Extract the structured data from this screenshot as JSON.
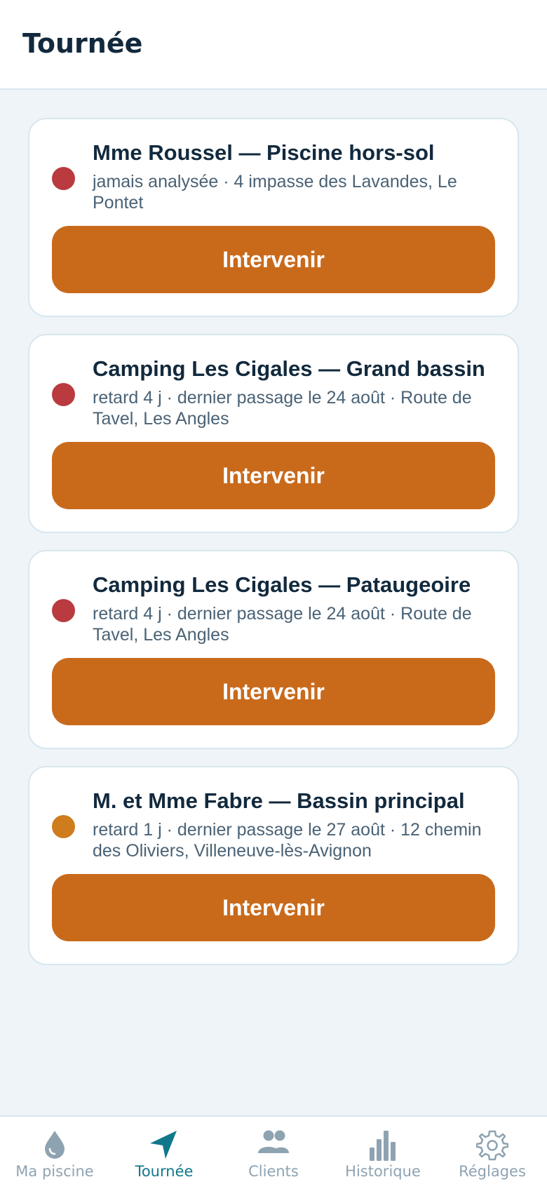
{
  "header": {
    "title": "Tournée"
  },
  "colors": {
    "accent": "#c96a1b",
    "late": "#b93a3f",
    "warning": "#cf7c1c",
    "active_tab": "#11788b",
    "inactive_tab": "#8ea3b2"
  },
  "cards": [
    {
      "title": "Mme Roussel — Piscine hors-sol",
      "subtitle": "jamais analysée · 4 impasse des Lavandes, Le Pontet",
      "status": "late",
      "status_color": "#b93a3f",
      "button": "Intervenir"
    },
    {
      "title": "Camping Les Cigales — Grand bassin",
      "subtitle": "retard 4 j · dernier passage le 24 août · Route de Tavel, Les Angles",
      "status": "late",
      "status_color": "#b93a3f",
      "button": "Intervenir"
    },
    {
      "title": "Camping Les Cigales — Pataugeoire",
      "subtitle": "retard 4 j · dernier passage le 24 août · Route de Tavel, Les Angles",
      "status": "late",
      "status_color": "#b93a3f",
      "button": "Intervenir"
    },
    {
      "title": "M. et Mme Fabre — Bassin principal",
      "subtitle": "retard 1 j · dernier passage le 27 août · 12 chemin des Oliviers, Villeneuve-lès-Avignon",
      "status": "warning",
      "status_color": "#cf7c1c",
      "button": "Intervenir"
    }
  ],
  "tabs": [
    {
      "label": "Ma piscine",
      "icon": "water-drop-icon",
      "active": false
    },
    {
      "label": "Tournée",
      "icon": "navigation-arrow-icon",
      "active": true
    },
    {
      "label": "Clients",
      "icon": "users-icon",
      "active": false
    },
    {
      "label": "Historique",
      "icon": "bar-chart-icon",
      "active": false
    },
    {
      "label": "Réglages",
      "icon": "gear-icon",
      "active": false
    }
  ]
}
